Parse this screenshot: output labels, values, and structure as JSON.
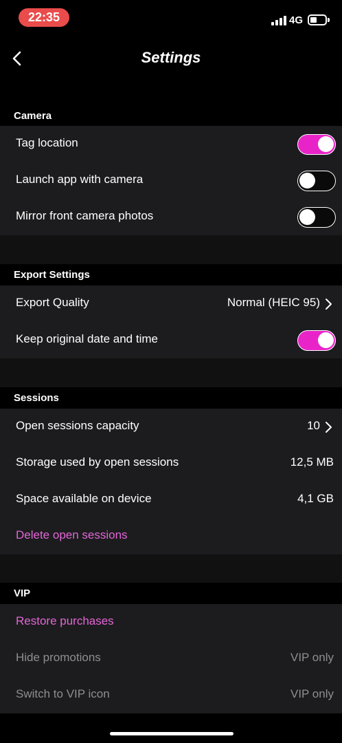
{
  "status": {
    "time": "22:35",
    "network": "4G",
    "time_color": "#ea4b4b"
  },
  "nav": {
    "title": "Settings"
  },
  "accent_color": "#e824c9",
  "link_color": "#e366d6",
  "sections": {
    "camera": {
      "title": "Camera",
      "tag_location": {
        "label": "Tag location",
        "on": true
      },
      "launch_app": {
        "label": "Launch app with camera",
        "on": false
      },
      "mirror_front": {
        "label": "Mirror front camera photos",
        "on": false
      }
    },
    "export": {
      "title": "Export Settings",
      "quality": {
        "label": "Export Quality",
        "value": "Normal (HEIC 95)"
      },
      "keep_date": {
        "label": "Keep original date and time",
        "on": true
      }
    },
    "sessions": {
      "title": "Sessions",
      "capacity": {
        "label": "Open sessions capacity",
        "value": "10"
      },
      "storage": {
        "label": "Storage used by open sessions",
        "value": "12,5 MB"
      },
      "space": {
        "label": "Space available on device",
        "value": "4,1 GB"
      },
      "delete": {
        "label": "Delete open sessions"
      }
    },
    "vip": {
      "title": "VIP",
      "restore": {
        "label": "Restore purchases"
      },
      "hide_promotions": {
        "label": "Hide promotions",
        "value": "VIP only"
      },
      "vip_icon": {
        "label": "Switch to VIP icon",
        "value": "VIP only"
      }
    }
  }
}
